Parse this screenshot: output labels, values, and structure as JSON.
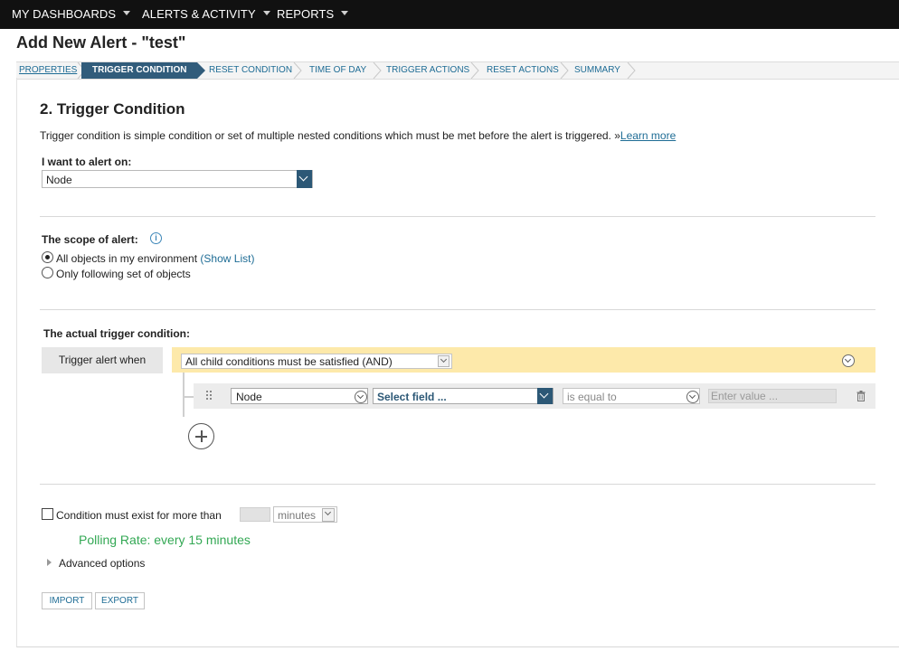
{
  "nav": {
    "items": [
      "MY DASHBOARDS",
      "ALERTS & ACTIVITY",
      "REPORTS"
    ]
  },
  "page": {
    "title": "Add New Alert - \"test\""
  },
  "wizard": {
    "steps": [
      "PROPERTIES",
      "TRIGGER CONDITION",
      "RESET CONDITION",
      "TIME OF DAY",
      "TRIGGER ACTIONS",
      "RESET ACTIONS",
      "SUMMARY"
    ],
    "active_step": "TRIGGER CONDITION"
  },
  "section": {
    "title": "2. Trigger Condition",
    "description": "Trigger condition is simple condition or set of multiple nested conditions which must be met before the alert is triggered. »",
    "learn_more": "Learn more"
  },
  "alert_on": {
    "label": "I want to alert on:",
    "value": "Node"
  },
  "scope": {
    "label": "The scope of alert:",
    "option_all": "All objects in my environment",
    "show_list": "(Show List)",
    "option_following": "Only following set of objects",
    "selected": "all"
  },
  "trigger": {
    "label": "The actual trigger condition:",
    "when_label": "Trigger alert when",
    "group_value": "All child conditions must be satisfied (AND)",
    "condition": {
      "object": "Node",
      "field_placeholder": "Select field ...",
      "operator": "is equal to",
      "value_placeholder": "Enter value ..."
    }
  },
  "duration": {
    "label": "Condition must exist for more than",
    "unit": "minutes",
    "checked": false
  },
  "polling_rate": "Polling Rate: every 15 minutes",
  "advanced": "Advanced options",
  "buttons": {
    "import": "IMPORT",
    "export": "EXPORT"
  },
  "colors": {
    "nav_bg": "#111111",
    "wizard_active": "#315c7b",
    "link": "#1e6c95",
    "and_bar": "#fde9aa",
    "polling": "#33a854"
  }
}
